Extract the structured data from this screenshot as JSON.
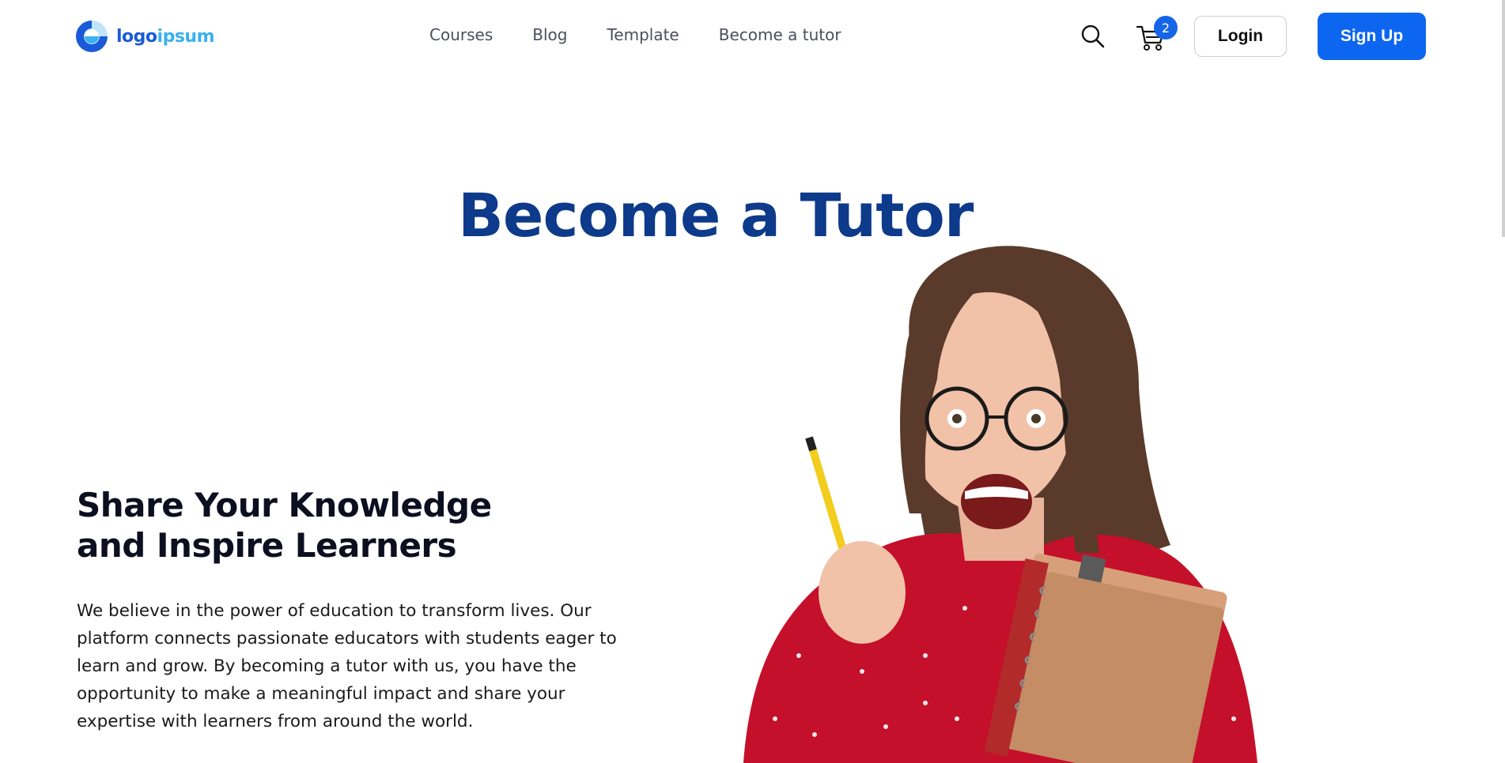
{
  "brand": {
    "name_part1": "logo",
    "name_part2": "ipsum",
    "icon": "logo-ring-icon",
    "colors": {
      "primary": "#1a5ad8",
      "secondary": "#3ab0f0"
    }
  },
  "nav": {
    "links": [
      {
        "label": "Courses"
      },
      {
        "label": "Blog"
      },
      {
        "label": "Template"
      },
      {
        "label": "Become a tutor"
      }
    ]
  },
  "header_actions": {
    "search_icon": "search-icon",
    "cart_icon": "cart-icon",
    "cart_count": "2",
    "login_label": "Login",
    "signup_label": "Sign Up"
  },
  "hero": {
    "title": "Become a Tutor",
    "subtitle_line1": "Share Your Knowledge",
    "subtitle_line2": "and Inspire Learners",
    "description_lines": [
      "We believe in the power of education to transform lives. Our",
      "platform connects passionate educators with students eager to",
      "learn and grow. By becoming a tutor with us, you have the",
      "opportunity to make a meaningful impact and share your",
      "expertise with learners from around the world."
    ],
    "image": "excited-student-with-glasses-pencil-and-notebooks"
  },
  "colors": {
    "accent": "#0d66f0",
    "title": "#0d3a8a",
    "text": "#1a1a1a"
  }
}
